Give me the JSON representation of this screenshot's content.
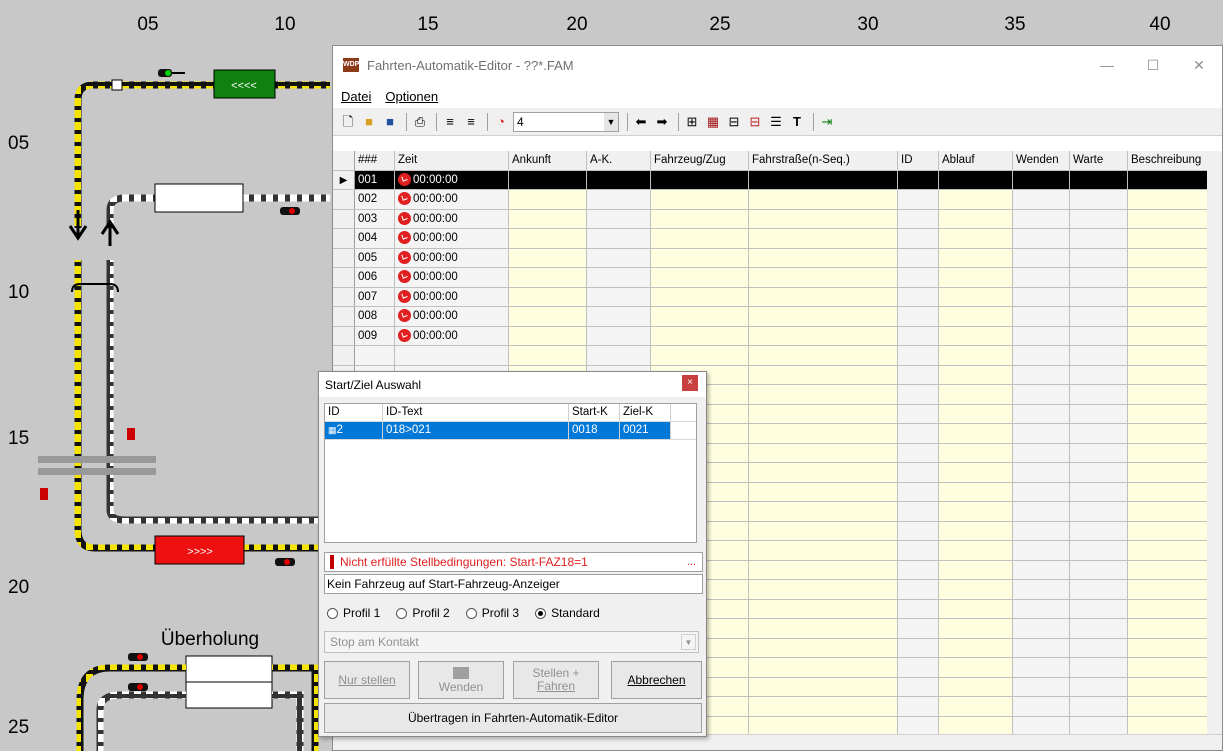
{
  "ruler": {
    "top": [
      "05",
      "10",
      "15",
      "20",
      "25",
      "30",
      "35",
      "40"
    ],
    "left": [
      "05",
      "10",
      "15",
      "20",
      "25"
    ]
  },
  "layout_labels": {
    "train_green": "<<<<",
    "train_red": ">>>>",
    "overtaking": "Überholung"
  },
  "window": {
    "title": "Fahrten-Automatik-Editor - ??*.FAM",
    "menu": [
      "Datei",
      "Optionen"
    ],
    "toolbar_counter": "4",
    "columns": [
      "###",
      "Zeit",
      "Ankunft",
      "A-K.",
      "Fahrzeug/Zug",
      "Fahrstraße(n-Seq.)",
      "ID",
      "Ablauf",
      "Wenden",
      "Warte",
      "Beschreibung"
    ],
    "rows": [
      {
        "nr": "001",
        "zeit": "00:00:00"
      },
      {
        "nr": "002",
        "zeit": "00:00:00"
      },
      {
        "nr": "003",
        "zeit": "00:00:00"
      },
      {
        "nr": "004",
        "zeit": "00:00:00"
      },
      {
        "nr": "005",
        "zeit": "00:00:00"
      },
      {
        "nr": "006",
        "zeit": "00:00:00"
      },
      {
        "nr": "007",
        "zeit": "00:00:00"
      },
      {
        "nr": "008",
        "zeit": "00:00:00"
      },
      {
        "nr": "009",
        "zeit": "00:00:00"
      }
    ]
  },
  "dialog": {
    "title": "Start/Ziel Auswahl",
    "close": "×",
    "columns": [
      "ID",
      "ID-Text",
      "Start-K",
      "Ziel-K"
    ],
    "rows": [
      {
        "id": "2",
        "text": "018>021",
        "start": "0018",
        "ziel": "0021"
      }
    ],
    "warning": "Nicht erfüllte Stellbedingungen: Start-FAZ18=1",
    "warning_more": "...",
    "info": "Kein Fahrzeug auf Start-Fahrzeug-Anzeiger",
    "profiles": [
      "Profil 1",
      "Profil 2",
      "Profil 3",
      "Standard"
    ],
    "selected_profile": "Standard",
    "stop_combo": "Stop am Kontakt",
    "buttons": {
      "nur_stellen": "Nur stellen",
      "wenden": "Wenden",
      "stellen_fahren_1": "Stellen +",
      "stellen_fahren_2": "Fahren",
      "abbrechen": "Abbrechen",
      "uebertragen": "Übertragen in Fahrten-Automatik-Editor"
    }
  },
  "colors": {
    "track_yellow": "#f5e400",
    "track_white": "#ffffff",
    "train_green": "#108010",
    "train_red": "#ee1010",
    "selection": "#0078d7",
    "grid_yellow": "#ffffe0"
  }
}
